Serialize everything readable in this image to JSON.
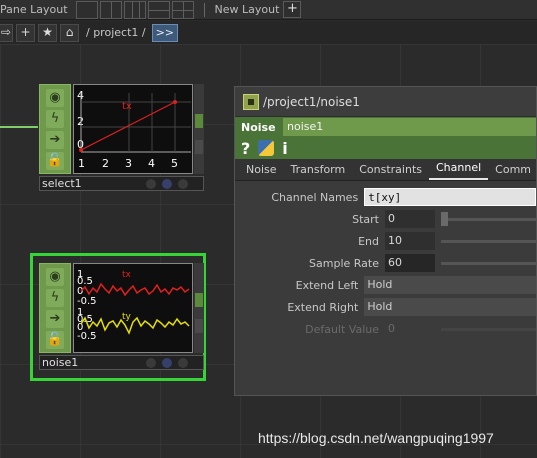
{
  "panebar": {
    "label": "Pane Layout",
    "new_layout": "New Layout",
    "add": "+"
  },
  "pathbar": {
    "buttons": [
      "⇨",
      "+",
      "★",
      "⌂"
    ],
    "path": "/ project1 /",
    "more": ">>"
  },
  "nodes": {
    "select1": {
      "name": "select1",
      "y_ticks": [
        "4",
        "2",
        "0"
      ],
      "x_ticks": [
        "1",
        "2",
        "3",
        "4",
        "5"
      ],
      "channel_label": "tx",
      "line_color": "#e02020"
    },
    "noise1": {
      "name": "noise1",
      "upper_labels": [
        "1",
        "0.5",
        "0",
        "-0.5"
      ],
      "lower_labels": [
        "1",
        "0.5",
        "0",
        "-0.5"
      ],
      "channel_tx": "tx",
      "channel_ty": "ty",
      "tx_color": "#e02020",
      "ty_color": "#e6e000",
      "selected_color": "#36d436"
    }
  },
  "dialog": {
    "title": "/project1/noise1",
    "op_type": "Noise",
    "op_name": "noise1",
    "help": "?",
    "info": "i",
    "tabs": [
      "Noise",
      "Transform",
      "Constraints",
      "Channel",
      "Comm"
    ],
    "active_tab": "Channel",
    "params": [
      {
        "label": "Channel Names",
        "value": "t[xy]",
        "kind": "text"
      },
      {
        "label": "Start",
        "value": "0",
        "kind": "num"
      },
      {
        "label": "End",
        "value": "10",
        "kind": "num"
      },
      {
        "label": "Sample Rate",
        "value": "60",
        "kind": "num"
      },
      {
        "label": "Extend Left",
        "value": "Hold",
        "kind": "select"
      },
      {
        "label": "Extend Right",
        "value": "Hold",
        "kind": "select"
      },
      {
        "label": "Default Value",
        "value": "0",
        "kind": "disabled"
      }
    ]
  },
  "watermark": "https://blog.csdn.net/wangpuqing1997"
}
